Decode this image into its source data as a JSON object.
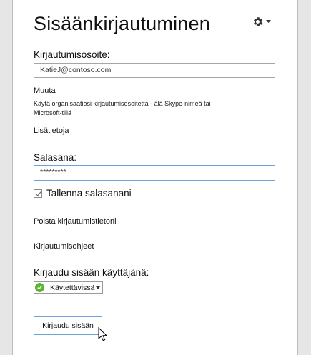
{
  "header": {
    "title": "Sisäänkirjautuminen"
  },
  "signin_address": {
    "label": "Kirjautumisosoite:",
    "value": "KatieJ@contoso.com",
    "change_link": "Muuta",
    "hint": "Käytä organisaatiosi kirjautumisosoitetta - älä Skype-nimeä tai Microsoft-tiliä",
    "more_info_link": "Lisätietoja"
  },
  "password": {
    "label": "Salasana:",
    "value": "*********"
  },
  "save_password": {
    "label": "Tallenna salasanani",
    "checked": true
  },
  "links": {
    "delete_info": "Poista kirjautumistietoni",
    "help": "Kirjautumisohjeet"
  },
  "sign_in_as": {
    "label": "Kirjaudu sisään käyttäjänä:",
    "status": "Käytettävissä",
    "status_color": "#5bb531"
  },
  "sign_in_button": {
    "label": "Kirjaudu sisään"
  },
  "colors": {
    "focus_border": "#6aa4d8",
    "available_green": "#5bb531"
  }
}
